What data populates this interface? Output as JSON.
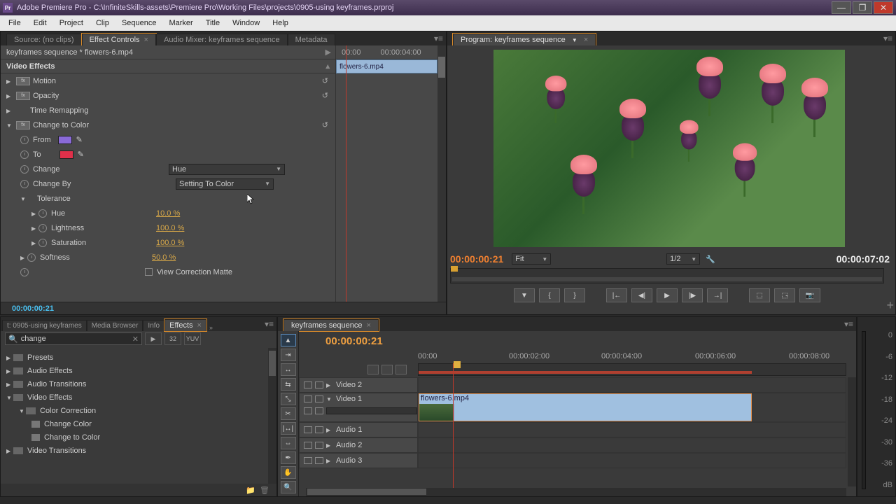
{
  "titlebar": {
    "app": "Adobe Premiere Pro",
    "path": "C:\\InfiniteSkills-assets\\Premiere Pro\\Working Files\\projects\\0905-using keyframes.prproj"
  },
  "menu": [
    "File",
    "Edit",
    "Project",
    "Clip",
    "Sequence",
    "Marker",
    "Title",
    "Window",
    "Help"
  ],
  "source_tabs": {
    "items": [
      "Source: (no clips)",
      "Effect Controls",
      "Audio Mixer: keyframes sequence",
      "Metadata"
    ],
    "active_index": 1
  },
  "effect_controls": {
    "header": "keyframes sequence * flowers-6.mp4",
    "section_title": "Video Effects",
    "time_labels": [
      "00:00",
      "00:00:04:00"
    ],
    "clip_label": "flowers-6.mp4",
    "footer_time": "00:00:00:21",
    "effects": {
      "motion": "Motion",
      "opacity": "Opacity",
      "time_remap": "Time Remapping",
      "ctc": {
        "title": "Change to Color",
        "from_label": "From",
        "from_color": "#8a6ad8",
        "to_label": "To",
        "to_color": "#e0304a",
        "change_label": "Change",
        "change_value": "Hue",
        "changeby_label": "Change By",
        "changeby_value": "Setting To Color",
        "tolerance_label": "Tolerance",
        "hue_label": "Hue",
        "hue_value": "10.0 %",
        "light_label": "Lightness",
        "light_value": "100.0 %",
        "sat_label": "Saturation",
        "sat_value": "100.0 %",
        "softness_label": "Softness",
        "softness_value": "50.0 %",
        "vcm_label": "View Correction Matte"
      }
    }
  },
  "program": {
    "tab": "Program: keyframes sequence",
    "timecode_left": "00:00:00:21",
    "fit": "Fit",
    "zoom": "1/2",
    "timecode_right": "00:00:07:02"
  },
  "effects_panel": {
    "tabs": [
      "t: 0905-using keyframes",
      "Media Browser",
      "Info",
      "Effects"
    ],
    "active_index": 3,
    "search_value": "change",
    "btn32": "32",
    "btnYUV": "YUV",
    "tree": {
      "presets": "Presets",
      "audio_effects": "Audio Effects",
      "audio_trans": "Audio Transitions",
      "video_effects": "Video Effects",
      "color_corr": "Color Correction",
      "change_color": "Change Color",
      "change_to_color": "Change to Color",
      "video_trans": "Video Transitions"
    }
  },
  "timeline": {
    "tab": "keyframes sequence",
    "timecode": "00:00:00:21",
    "ruler": [
      "00:00",
      "00:00:02:00",
      "00:00:04:00",
      "00:00:06:00",
      "00:00:08:00"
    ],
    "tracks": {
      "v2": "Video 2",
      "v1": "Video 1",
      "a1": "Audio 1",
      "a2": "Audio 2",
      "a3": "Audio 3"
    },
    "clip_name": "flowers-6.mp4"
  },
  "meter_ticks": [
    "0",
    "-6",
    "-12",
    "-18",
    "-24",
    "-30",
    "-36",
    "dB"
  ]
}
